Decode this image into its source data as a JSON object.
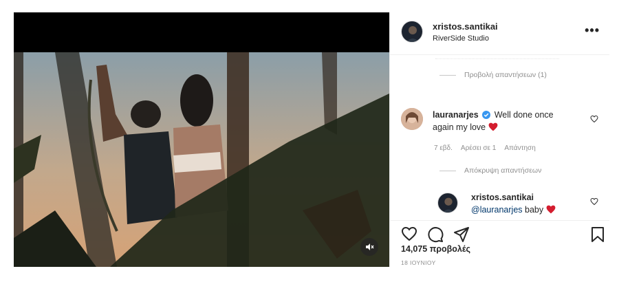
{
  "post": {
    "owner": {
      "username": "xristos.santikai",
      "location": "RiverSide Studio"
    },
    "more_label": "•••"
  },
  "comments": {
    "view_replies_label": "Προβολή απαντήσεων (1)",
    "hide_replies_label": "Απόκρυψη απαντήσεων",
    "items": [
      {
        "username": "lauranarjes",
        "verified": true,
        "text_line1": "Well done once",
        "text_line2": "again my love",
        "time": "7 εβδ.",
        "likes": "Αρέσει σε 1",
        "reply_label": "Απάντηση"
      }
    ],
    "reply": {
      "username": "xristos.santikai",
      "mention": "@lauranarjes",
      "text": "baby"
    }
  },
  "stats": {
    "views": "14,075 προβολές",
    "date": "18 ΙΟΥΝΙΟΥ"
  },
  "colors": {
    "heart": "#ed4956",
    "verified": "#3897f0",
    "mention": "#00376b"
  }
}
